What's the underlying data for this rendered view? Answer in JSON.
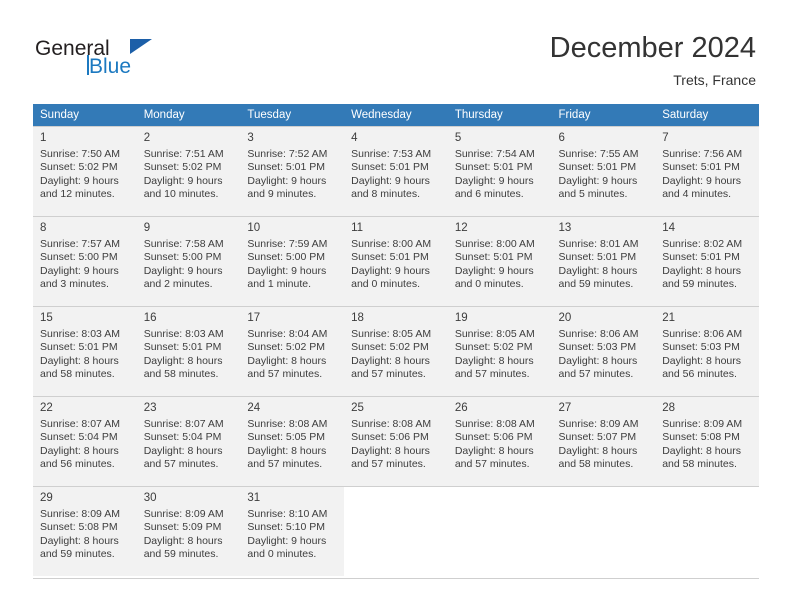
{
  "brand": {
    "name_part1": "General",
    "name_part2": "Blue",
    "logo_icon": "triangle-flag-icon",
    "accent_color": "#1c79c0",
    "dark_color": "#1c5fa8"
  },
  "header": {
    "title": "December 2024",
    "subtitle": "Trets, France"
  },
  "theme": {
    "header_row_bg": "#337ab7",
    "shaded_row_bg": "#f2f2f2",
    "grid_line": "#cfcfcf",
    "text_color": "#3d3d3d"
  },
  "columns": [
    "Sunday",
    "Monday",
    "Tuesday",
    "Wednesday",
    "Thursday",
    "Friday",
    "Saturday"
  ],
  "weeks": [
    {
      "shaded": true,
      "days": [
        {
          "num": "1",
          "sunrise": "Sunrise: 7:50 AM",
          "sunset": "Sunset: 5:02 PM",
          "daylight1": "Daylight: 9 hours",
          "daylight2": "and 12 minutes."
        },
        {
          "num": "2",
          "sunrise": "Sunrise: 7:51 AM",
          "sunset": "Sunset: 5:02 PM",
          "daylight1": "Daylight: 9 hours",
          "daylight2": "and 10 minutes."
        },
        {
          "num": "3",
          "sunrise": "Sunrise: 7:52 AM",
          "sunset": "Sunset: 5:01 PM",
          "daylight1": "Daylight: 9 hours",
          "daylight2": "and 9 minutes."
        },
        {
          "num": "4",
          "sunrise": "Sunrise: 7:53 AM",
          "sunset": "Sunset: 5:01 PM",
          "daylight1": "Daylight: 9 hours",
          "daylight2": "and 8 minutes."
        },
        {
          "num": "5",
          "sunrise": "Sunrise: 7:54 AM",
          "sunset": "Sunset: 5:01 PM",
          "daylight1": "Daylight: 9 hours",
          "daylight2": "and 6 minutes."
        },
        {
          "num": "6",
          "sunrise": "Sunrise: 7:55 AM",
          "sunset": "Sunset: 5:01 PM",
          "daylight1": "Daylight: 9 hours",
          "daylight2": "and 5 minutes."
        },
        {
          "num": "7",
          "sunrise": "Sunrise: 7:56 AM",
          "sunset": "Sunset: 5:01 PM",
          "daylight1": "Daylight: 9 hours",
          "daylight2": "and 4 minutes."
        }
      ]
    },
    {
      "shaded": true,
      "days": [
        {
          "num": "8",
          "sunrise": "Sunrise: 7:57 AM",
          "sunset": "Sunset: 5:00 PM",
          "daylight1": "Daylight: 9 hours",
          "daylight2": "and 3 minutes."
        },
        {
          "num": "9",
          "sunrise": "Sunrise: 7:58 AM",
          "sunset": "Sunset: 5:00 PM",
          "daylight1": "Daylight: 9 hours",
          "daylight2": "and 2 minutes."
        },
        {
          "num": "10",
          "sunrise": "Sunrise: 7:59 AM",
          "sunset": "Sunset: 5:00 PM",
          "daylight1": "Daylight: 9 hours",
          "daylight2": "and 1 minute."
        },
        {
          "num": "11",
          "sunrise": "Sunrise: 8:00 AM",
          "sunset": "Sunset: 5:01 PM",
          "daylight1": "Daylight: 9 hours",
          "daylight2": "and 0 minutes."
        },
        {
          "num": "12",
          "sunrise": "Sunrise: 8:00 AM",
          "sunset": "Sunset: 5:01 PM",
          "daylight1": "Daylight: 9 hours",
          "daylight2": "and 0 minutes."
        },
        {
          "num": "13",
          "sunrise": "Sunrise: 8:01 AM",
          "sunset": "Sunset: 5:01 PM",
          "daylight1": "Daylight: 8 hours",
          "daylight2": "and 59 minutes."
        },
        {
          "num": "14",
          "sunrise": "Sunrise: 8:02 AM",
          "sunset": "Sunset: 5:01 PM",
          "daylight1": "Daylight: 8 hours",
          "daylight2": "and 59 minutes."
        }
      ]
    },
    {
      "shaded": true,
      "days": [
        {
          "num": "15",
          "sunrise": "Sunrise: 8:03 AM",
          "sunset": "Sunset: 5:01 PM",
          "daylight1": "Daylight: 8 hours",
          "daylight2": "and 58 minutes."
        },
        {
          "num": "16",
          "sunrise": "Sunrise: 8:03 AM",
          "sunset": "Sunset: 5:01 PM",
          "daylight1": "Daylight: 8 hours",
          "daylight2": "and 58 minutes."
        },
        {
          "num": "17",
          "sunrise": "Sunrise: 8:04 AM",
          "sunset": "Sunset: 5:02 PM",
          "daylight1": "Daylight: 8 hours",
          "daylight2": "and 57 minutes."
        },
        {
          "num": "18",
          "sunrise": "Sunrise: 8:05 AM",
          "sunset": "Sunset: 5:02 PM",
          "daylight1": "Daylight: 8 hours",
          "daylight2": "and 57 minutes."
        },
        {
          "num": "19",
          "sunrise": "Sunrise: 8:05 AM",
          "sunset": "Sunset: 5:02 PM",
          "daylight1": "Daylight: 8 hours",
          "daylight2": "and 57 minutes."
        },
        {
          "num": "20",
          "sunrise": "Sunrise: 8:06 AM",
          "sunset": "Sunset: 5:03 PM",
          "daylight1": "Daylight: 8 hours",
          "daylight2": "and 57 minutes."
        },
        {
          "num": "21",
          "sunrise": "Sunrise: 8:06 AM",
          "sunset": "Sunset: 5:03 PM",
          "daylight1": "Daylight: 8 hours",
          "daylight2": "and 56 minutes."
        }
      ]
    },
    {
      "shaded": true,
      "days": [
        {
          "num": "22",
          "sunrise": "Sunrise: 8:07 AM",
          "sunset": "Sunset: 5:04 PM",
          "daylight1": "Daylight: 8 hours",
          "daylight2": "and 56 minutes."
        },
        {
          "num": "23",
          "sunrise": "Sunrise: 8:07 AM",
          "sunset": "Sunset: 5:04 PM",
          "daylight1": "Daylight: 8 hours",
          "daylight2": "and 57 minutes."
        },
        {
          "num": "24",
          "sunrise": "Sunrise: 8:08 AM",
          "sunset": "Sunset: 5:05 PM",
          "daylight1": "Daylight: 8 hours",
          "daylight2": "and 57 minutes."
        },
        {
          "num": "25",
          "sunrise": "Sunrise: 8:08 AM",
          "sunset": "Sunset: 5:06 PM",
          "daylight1": "Daylight: 8 hours",
          "daylight2": "and 57 minutes."
        },
        {
          "num": "26",
          "sunrise": "Sunrise: 8:08 AM",
          "sunset": "Sunset: 5:06 PM",
          "daylight1": "Daylight: 8 hours",
          "daylight2": "and 57 minutes."
        },
        {
          "num": "27",
          "sunrise": "Sunrise: 8:09 AM",
          "sunset": "Sunset: 5:07 PM",
          "daylight1": "Daylight: 8 hours",
          "daylight2": "and 58 minutes."
        },
        {
          "num": "28",
          "sunrise": "Sunrise: 8:09 AM",
          "sunset": "Sunset: 5:08 PM",
          "daylight1": "Daylight: 8 hours",
          "daylight2": "and 58 minutes."
        }
      ]
    },
    {
      "shaded": true,
      "days": [
        {
          "num": "29",
          "sunrise": "Sunrise: 8:09 AM",
          "sunset": "Sunset: 5:08 PM",
          "daylight1": "Daylight: 8 hours",
          "daylight2": "and 59 minutes."
        },
        {
          "num": "30",
          "sunrise": "Sunrise: 8:09 AM",
          "sunset": "Sunset: 5:09 PM",
          "daylight1": "Daylight: 8 hours",
          "daylight2": "and 59 minutes."
        },
        {
          "num": "31",
          "sunrise": "Sunrise: 8:10 AM",
          "sunset": "Sunset: 5:10 PM",
          "daylight1": "Daylight: 9 hours",
          "daylight2": "and 0 minutes."
        },
        {
          "num": "",
          "sunrise": "",
          "sunset": "",
          "daylight1": "",
          "daylight2": ""
        },
        {
          "num": "",
          "sunrise": "",
          "sunset": "",
          "daylight1": "",
          "daylight2": ""
        },
        {
          "num": "",
          "sunrise": "",
          "sunset": "",
          "daylight1": "",
          "daylight2": ""
        },
        {
          "num": "",
          "sunrise": "",
          "sunset": "",
          "daylight1": "",
          "daylight2": ""
        }
      ]
    }
  ]
}
